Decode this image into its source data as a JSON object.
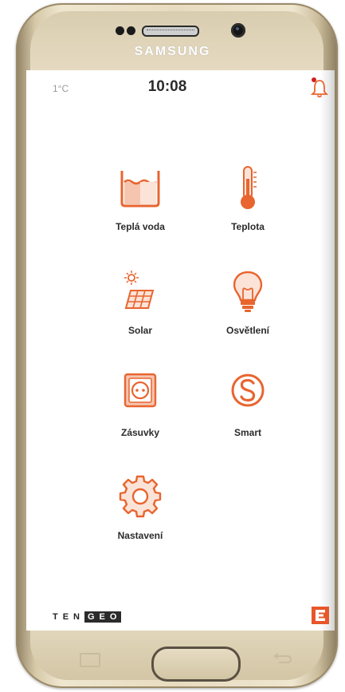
{
  "device": {
    "brand": "SAMSUNG"
  },
  "status_bar": {
    "temperature": "1°C",
    "time": "10:08",
    "alert_dot_color": "#d21f1f"
  },
  "accent_color": "#e8652f",
  "tiles": [
    {
      "label": "Teplá voda",
      "icon": "water-tank-icon"
    },
    {
      "label": "Teplota",
      "icon": "thermometer-icon"
    },
    {
      "label": "Solar",
      "icon": "solar-panel-icon"
    },
    {
      "label": "Osvětlení",
      "icon": "light-bulb-icon"
    },
    {
      "label": "Zásuvky",
      "icon": "power-socket-icon"
    },
    {
      "label": "Smart",
      "icon": "smart-s-icon"
    },
    {
      "label": "Nastavení",
      "icon": "gear-icon"
    }
  ],
  "footer": {
    "logo_left": "TEN",
    "logo_right": "GEO",
    "partner_icon": "cez-logo-icon"
  }
}
